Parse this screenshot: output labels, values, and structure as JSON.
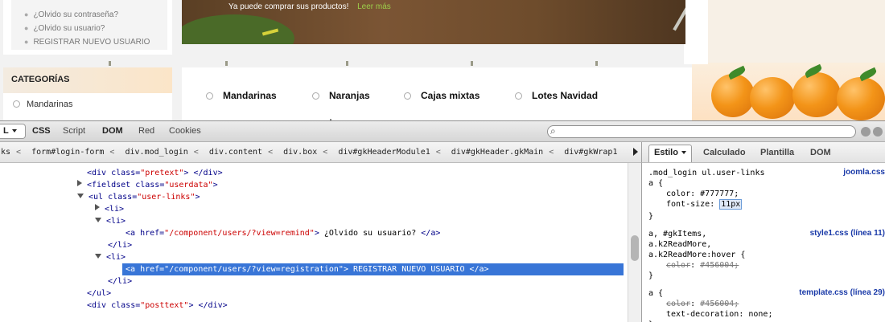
{
  "site": {
    "user_links": [
      "¿Olvido su contraseña?",
      "¿Olvido su usuario?",
      "REGISTRAR NUEVO USUARIO"
    ],
    "hero": {
      "text": "Ya puede comprar sus productos!",
      "link": "Leer más"
    },
    "categories": {
      "title": "CATEGORÍAS",
      "items": [
        "Mandarinas"
      ]
    },
    "product_menu": [
      "Mandarinas",
      "Naranjas",
      "Cajas mixtas",
      "Lotes Navidad"
    ]
  },
  "firebug": {
    "toolbar": {
      "html_label": "L",
      "tabs": [
        "CSS",
        "Script",
        "DOM",
        "Red",
        "Cookies"
      ]
    },
    "breadcrumb": [
      "ks",
      "form#login-form",
      "div.mod_login",
      "div.content",
      "div.box",
      "div#gkHeaderModule1",
      "div#gkHeader.gkMain",
      "div#gkWrap1"
    ],
    "side_tabs": [
      "Estilo",
      "Calculado",
      "Plantilla",
      "DOM"
    ],
    "html_tree": [
      {
        "indent": 108,
        "twisty": "none",
        "parts": [
          [
            "tag",
            "<div "
          ],
          [
            "attr-name",
            "class="
          ],
          [
            "attr-val",
            "\"pretext\""
          ],
          [
            "tag",
            ">"
          ],
          [
            "plain",
            "  "
          ],
          [
            "tag",
            "</div>"
          ]
        ]
      },
      {
        "indent": 96,
        "twisty": "closed",
        "parts": [
          [
            "tag",
            "<fieldset "
          ],
          [
            "attr-name",
            "class="
          ],
          [
            "attr-val",
            "\"userdata\""
          ],
          [
            "tag",
            ">"
          ]
        ]
      },
      {
        "indent": 96,
        "twisty": "open",
        "parts": [
          [
            "tag",
            "<ul "
          ],
          [
            "attr-name",
            "class="
          ],
          [
            "attr-val",
            "\"user-links\""
          ],
          [
            "tag",
            ">"
          ]
        ]
      },
      {
        "indent": 118,
        "twisty": "closed",
        "parts": [
          [
            "tag",
            "<li>"
          ]
        ]
      },
      {
        "indent": 118,
        "twisty": "open",
        "parts": [
          [
            "tag",
            "<li>"
          ]
        ]
      },
      {
        "indent": 156,
        "twisty": "none",
        "parts": [
          [
            "tag",
            "<a "
          ],
          [
            "attr-name",
            "href="
          ],
          [
            "attr-val",
            "\"/component/users/?view=remind\""
          ],
          [
            "tag",
            ">"
          ],
          [
            "plain",
            " ¿Olvido su usuario? "
          ],
          [
            "tag",
            "</a>"
          ]
        ]
      },
      {
        "indent": 134,
        "twisty": "none",
        "parts": [
          [
            "tag",
            "</li>"
          ]
        ]
      },
      {
        "indent": 118,
        "twisty": "open",
        "parts": [
          [
            "tag",
            "<li>"
          ]
        ]
      },
      {
        "indent": 156,
        "twisty": "none",
        "selected": true,
        "parts": [
          [
            "tag",
            "<a "
          ],
          [
            "attr-name",
            "href="
          ],
          [
            "attr-val",
            "\"/component/users/?view=registration\""
          ],
          [
            "tag",
            ">"
          ],
          [
            "plain",
            " REGISTRAR NUEVO USUARIO "
          ],
          [
            "tag",
            "</a>"
          ]
        ]
      },
      {
        "indent": 134,
        "twisty": "none",
        "parts": [
          [
            "tag",
            "</li>"
          ]
        ]
      },
      {
        "indent": 108,
        "twisty": "none",
        "parts": [
          [
            "tag",
            "</ul>"
          ]
        ]
      },
      {
        "indent": 108,
        "twisty": "none",
        "parts": [
          [
            "tag",
            "<div "
          ],
          [
            "attr-name",
            "class="
          ],
          [
            "attr-val",
            "\"posttext\""
          ],
          [
            "tag",
            ">"
          ],
          [
            "plain",
            "  "
          ],
          [
            "tag",
            "</div>"
          ]
        ]
      }
    ],
    "style_rules": [
      {
        "selector": [
          ".mod_login ul.user-links",
          "a {"
        ],
        "source": "joomla.css",
        "props": [
          {
            "name": "color",
            "value": "#777777;",
            "strike": false
          },
          {
            "name": "font-size",
            "value": "11px",
            "strike": false,
            "editing": true
          }
        ]
      },
      {
        "selector": [
          "a, #gkItems,",
          "a.k2ReadMore,",
          "a.k2ReadMore:hover {"
        ],
        "source": "style1.css (línea 11)",
        "props": [
          {
            "name": "color",
            "value": "#456004;",
            "strike": true
          }
        ]
      },
      {
        "selector": [
          "a {"
        ],
        "source": "template.css (línea 29)",
        "props": [
          {
            "name": "color",
            "value": "#456004;",
            "strike": true
          },
          {
            "name": "text-decoration",
            "value": "none;",
            "strike": false
          }
        ]
      }
    ]
  }
}
